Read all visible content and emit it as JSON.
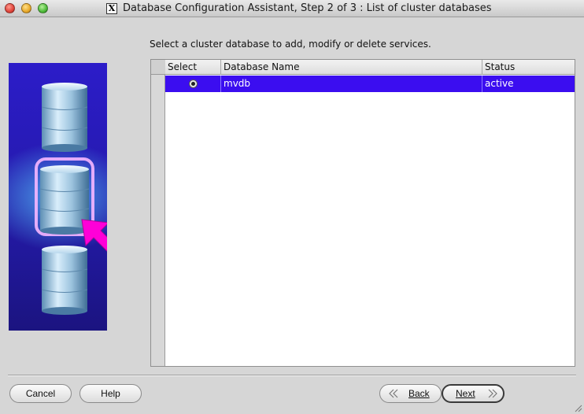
{
  "window": {
    "title": "Database Configuration Assistant, Step 2 of 3 : List of cluster databases",
    "app_badge": "X"
  },
  "instruction": "Select a cluster database to add, modify or delete services.",
  "table": {
    "columns": [
      "Select",
      "Database Name",
      "Status"
    ],
    "rows": [
      {
        "selected": true,
        "database_name": "mvdb",
        "status": "active"
      }
    ]
  },
  "buttons": {
    "cancel": "Cancel",
    "help": "Help",
    "back": "Back",
    "next": "Next"
  },
  "colors": {
    "selection": "#3b0df0",
    "illustration_bg": "#2c1cc9",
    "arrow": "#ff00d8"
  },
  "icons": {
    "close": "close-traffic-light-icon",
    "minimize": "minimize-traffic-light-icon",
    "maximize": "maximize-traffic-light-icon",
    "app": "x11-app-icon",
    "back": "double-chevron-left-icon",
    "next": "double-chevron-right-icon",
    "illustration": "database-cylinders-with-arrow-icon"
  }
}
